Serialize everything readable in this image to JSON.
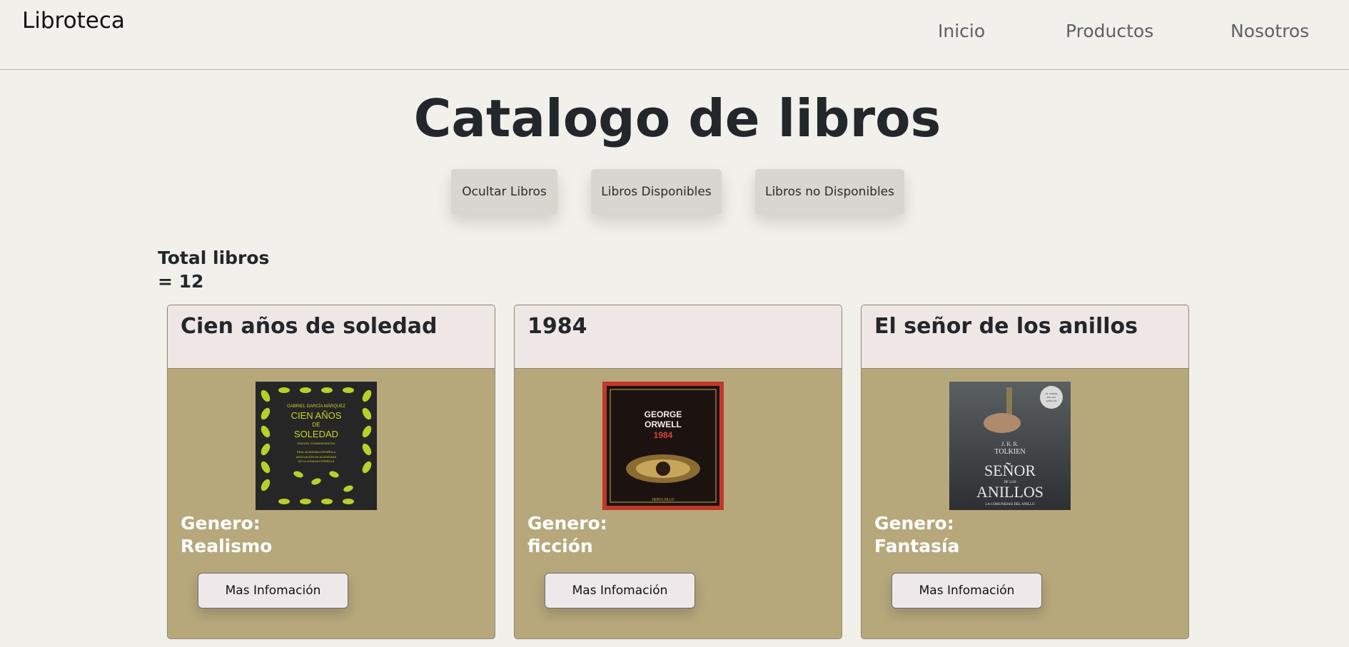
{
  "nav": {
    "brand": "Libroteca",
    "links": [
      "Inicio",
      "Productos",
      "Nosotros"
    ]
  },
  "main": {
    "title": "Catalogo de libros",
    "filters": [
      "Ocultar Libros",
      "Libros Disponibles",
      "Libros no Disponibles"
    ],
    "total_label": "Total libros",
    "total_value": "= 12"
  },
  "books": [
    {
      "title": "Cien años de soledad",
      "genre_label": "Genero:",
      "genre": "Realismo",
      "button": "Mas Infomación",
      "cover": {
        "author": "GABRIEL GARCÍA MÁRQUEZ",
        "line1": "CIEN AÑOS",
        "line2": "DE",
        "line3": "SOLEDAD",
        "sub1": "EDICIÓN CONMEMORATIVA",
        "sub2": "REAL ACADEMIA ESPAÑOLA",
        "sub3": "ASOCIACIÓN DE ACADEMIAS",
        "sub4": "DE LA LENGUA ESPAÑOLA",
        "colors": {
          "bg": "#262626",
          "leaf": "#b9cf2a",
          "text": "#c6d52c"
        }
      }
    },
    {
      "title": "1984",
      "genre_label": "Genero:",
      "genre": "ficción",
      "button": "Mas Infomación",
      "cover": {
        "author1": "GEORGE",
        "author2": "ORWELL",
        "line1": "1984",
        "publisher": "DEBOLSILLO",
        "colors": {
          "frame": "#c0392b",
          "bg": "#1c1310",
          "accent": "#d24536",
          "eye": "#c7a55a"
        }
      }
    },
    {
      "title": "El señor de los anillos",
      "genre_label": "Genero:",
      "genre": "Fantasía",
      "button": "Mas Infomación",
      "cover": {
        "badge1": "EL SEÑOR",
        "badge2": "DE LOS",
        "badge3": "ANILLOS",
        "author": "J. R. R.",
        "author2": "TOLKIEN",
        "line1": "SEÑOR",
        "line2": "DE LOS",
        "line3": "ANILLOS",
        "sub": "LA COMUNIDAD DEL ANILLO",
        "colors": {
          "bg": "#3f4446",
          "text": "#e6e6e6"
        }
      }
    }
  ],
  "colors": {
    "page_bg": "#f1f0ea",
    "card_body": "#b7a87c",
    "card_header": "#efe7e6",
    "filter_btn": "#d8d6ce"
  }
}
